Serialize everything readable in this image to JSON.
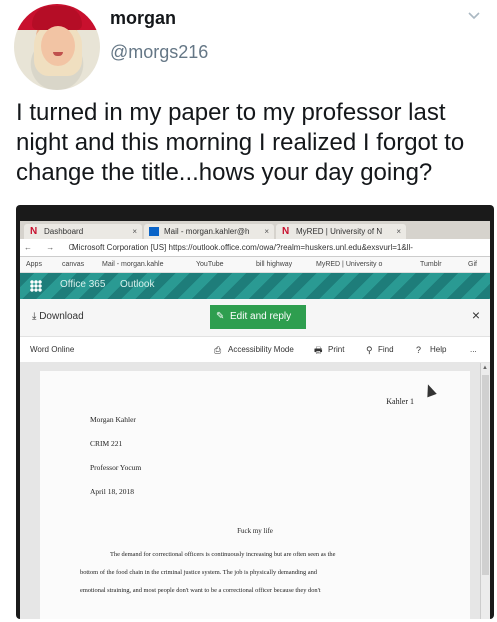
{
  "tweet": {
    "name": "morgan",
    "handle": "@morgs216",
    "text": "I turned in my paper to my professor last night and this morning I realized I forgot to change the title...hows your day going?"
  },
  "browser": {
    "tabs": [
      {
        "label": "Dashboard",
        "icon": "N"
      },
      {
        "label": "Mail - morgan.kahler@h",
        "icon": "outlook-icon"
      },
      {
        "label": "MyRED | University of N",
        "icon": "N"
      }
    ],
    "address": {
      "site": "Microsoft Corporation [US]",
      "url": "https://outlook.office.com/owa/?realm=huskers.unl.edu&exsvurl=1&ll-"
    },
    "bookmarks": [
      "Apps",
      "canvas",
      "Mail - morgan.kahle",
      "YouTube",
      "bill highway",
      "MyRED | University o",
      "Tumblr",
      "Gif"
    ]
  },
  "office": {
    "product1": "Office 365",
    "product2": "Outlook"
  },
  "commands": {
    "download": "Download",
    "edit_reply": "Edit and reply",
    "word_online": "Word Online",
    "accessibility": "Accessibility Mode",
    "print": "Print",
    "find": "Find",
    "help": "Help",
    "more": "..."
  },
  "document": {
    "header_right": "Kahler 1",
    "lines": [
      "Morgan Kahler",
      "CRIM 221",
      "Professor Yocum",
      "April 18, 2018"
    ],
    "title": "Fuck my life",
    "body": [
      "The demand for correctional officers is continuously increasing but are often seen as the",
      "bottom of the food chain in the criminal justice system. The job is physically demanding and",
      "emotional straining, and most people don't want to be a correctional officer because they don't"
    ]
  }
}
